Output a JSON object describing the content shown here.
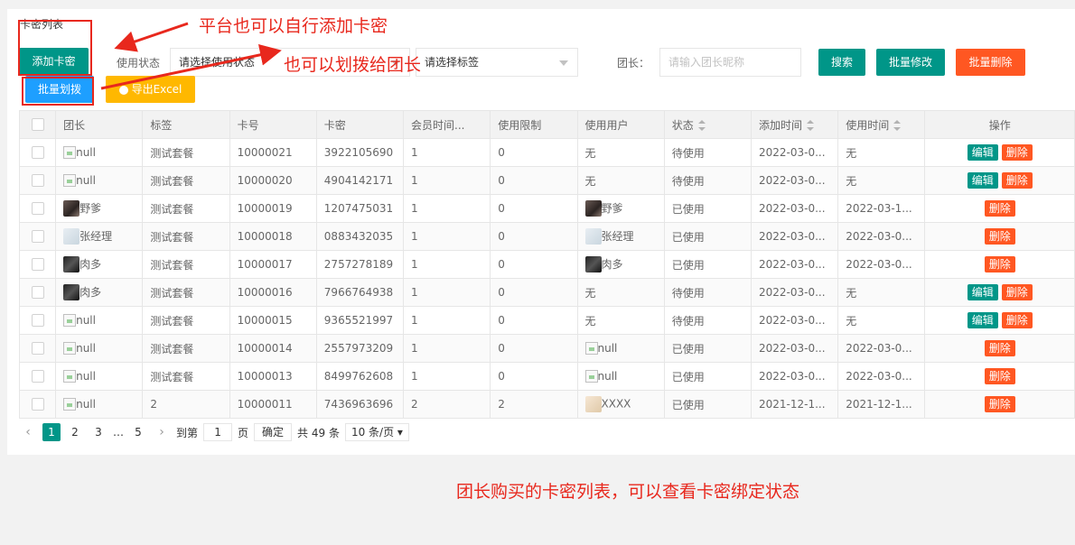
{
  "card": {
    "title": "卡密列表"
  },
  "toolbar": {
    "add_label": "添加卡密",
    "batch_edit_label": "批量修改",
    "batch_delete_label": "批量删除",
    "search_label": "搜索",
    "batch_assign_label": "批量划拨",
    "export_label": "导出Excel"
  },
  "filters": {
    "status_label": "使用状态",
    "status_value": "请选择使用状态",
    "tag_value": "请选择标签",
    "leader_label": "团长：",
    "leader_placeholder": "请输入团长昵称"
  },
  "table": {
    "headers": [
      "团长",
      "标签",
      "卡号",
      "卡密",
      "会员时间...",
      "使用限制",
      "使用用户",
      "状态",
      "添加时间",
      "使用时间",
      "操作"
    ],
    "rows": [
      {
        "leader": "null",
        "tag": "测试套餐",
        "card_no": "10000021",
        "secret": "3922105690",
        "member_time": "1",
        "limit": "0",
        "user": "无",
        "status": "待使用",
        "added": "2022-03-0...",
        "used": "无",
        "edit": "编辑",
        "del": "删除"
      },
      {
        "leader": "null",
        "tag": "测试套餐",
        "card_no": "10000020",
        "secret": "4904142171",
        "member_time": "1",
        "limit": "0",
        "user": "无",
        "status": "待使用",
        "added": "2022-03-0...",
        "used": "无",
        "edit": "编辑",
        "del": "删除"
      },
      {
        "leader": "野爹",
        "tag": "测试套餐",
        "card_no": "10000019",
        "secret": "1207475031",
        "member_time": "1",
        "limit": "0",
        "user": "野爹",
        "status": "已使用",
        "added": "2022-03-0...",
        "used": "2022-03-1...",
        "edit": "",
        "del": "删除"
      },
      {
        "leader": "张经理",
        "tag": "测试套餐",
        "card_no": "10000018",
        "secret": "0883432035",
        "member_time": "1",
        "limit": "0",
        "user": "张经理",
        "status": "已使用",
        "added": "2022-03-0...",
        "used": "2022-03-0...",
        "edit": "",
        "del": "删除"
      },
      {
        "leader": "肉多",
        "tag": "测试套餐",
        "card_no": "10000017",
        "secret": "2757278189",
        "member_time": "1",
        "limit": "0",
        "user": "肉多",
        "status": "已使用",
        "added": "2022-03-0...",
        "used": "2022-03-0...",
        "edit": "",
        "del": "删除"
      },
      {
        "leader": "肉多",
        "tag": "测试套餐",
        "card_no": "10000016",
        "secret": "7966764938",
        "member_time": "1",
        "limit": "0",
        "user": "无",
        "status": "待使用",
        "added": "2022-03-0...",
        "used": "无",
        "edit": "编辑",
        "del": "删除"
      },
      {
        "leader": "null",
        "tag": "测试套餐",
        "card_no": "10000015",
        "secret": "9365521997",
        "member_time": "1",
        "limit": "0",
        "user": "无",
        "status": "待使用",
        "added": "2022-03-0...",
        "used": "无",
        "edit": "编辑",
        "del": "删除"
      },
      {
        "leader": "null",
        "tag": "测试套餐",
        "card_no": "10000014",
        "secret": "2557973209",
        "member_time": "1",
        "limit": "0",
        "user": "null",
        "status": "已使用",
        "added": "2022-03-0...",
        "used": "2022-03-0...",
        "edit": "",
        "del": "删除"
      },
      {
        "leader": "null",
        "tag": "测试套餐",
        "card_no": "10000013",
        "secret": "8499762608",
        "member_time": "1",
        "limit": "0",
        "user": "null",
        "status": "已使用",
        "added": "2022-03-0...",
        "used": "2022-03-0...",
        "edit": "",
        "del": "删除"
      },
      {
        "leader": "null",
        "tag": "2",
        "card_no": "10000011",
        "secret": "7436963696",
        "member_time": "2",
        "limit": "2",
        "user": "XXXX",
        "status": "已使用",
        "added": "2021-12-1...",
        "used": "2021-12-1...",
        "edit": "",
        "del": "删除"
      }
    ]
  },
  "pagination": {
    "pages": [
      "1",
      "2",
      "3"
    ],
    "ellipsis": "…",
    "last_page": "5",
    "goto_label": "到第",
    "goto_value": "1",
    "page_unit": "页",
    "confirm_label": "确定",
    "total_label": "共 49 条",
    "page_size": "10 条/页"
  },
  "annotations": {
    "top_note": "平台也可以自行添加卡密",
    "mid_note": "也可以划拨给团长",
    "bottom_note": "团长购买的卡密列表，可以查看卡密绑定状态"
  },
  "colors": {
    "primary": "#009688",
    "danger": "#ff5722",
    "info": "#1e9fff",
    "warning": "#ffb800",
    "annotation": "#e8281d"
  }
}
